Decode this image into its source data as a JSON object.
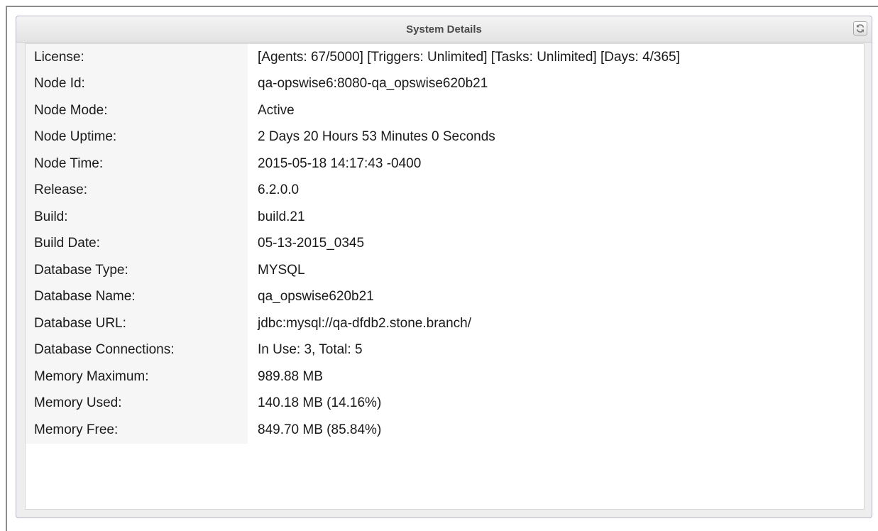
{
  "panel": {
    "title": "System Details",
    "refresh_icon": "refresh-icon"
  },
  "details": [
    {
      "label": "License:",
      "value": "[Agents: 67/5000] [Triggers: Unlimited] [Tasks: Unlimited] [Days: 4/365]"
    },
    {
      "label": "Node Id:",
      "value": "qa-opswise6:8080-qa_opswise620b21"
    },
    {
      "label": "Node Mode:",
      "value": "Active"
    },
    {
      "label": "Node Uptime:",
      "value": "2 Days 20 Hours 53 Minutes 0 Seconds"
    },
    {
      "label": "Node Time:",
      "value": "2015-05-18 14:17:43 -0400"
    },
    {
      "label": "Release:",
      "value": "6.2.0.0"
    },
    {
      "label": "Build:",
      "value": "build.21"
    },
    {
      "label": "Build Date:",
      "value": "05-13-2015_0345"
    },
    {
      "label": "Database Type:",
      "value": "MYSQL"
    },
    {
      "label": "Database Name:",
      "value": "qa_opswise620b21"
    },
    {
      "label": "Database URL:",
      "value": "jdbc:mysql://qa-dfdb2.stone.branch/"
    },
    {
      "label": "Database Connections:",
      "value": "In Use: 3, Total: 5"
    },
    {
      "label": "Memory Maximum:",
      "value": "989.88 MB"
    },
    {
      "label": "Memory Used:",
      "value": "140.18 MB (14.16%)"
    },
    {
      "label": "Memory Free:",
      "value": "849.70 MB (85.84%)"
    }
  ]
}
